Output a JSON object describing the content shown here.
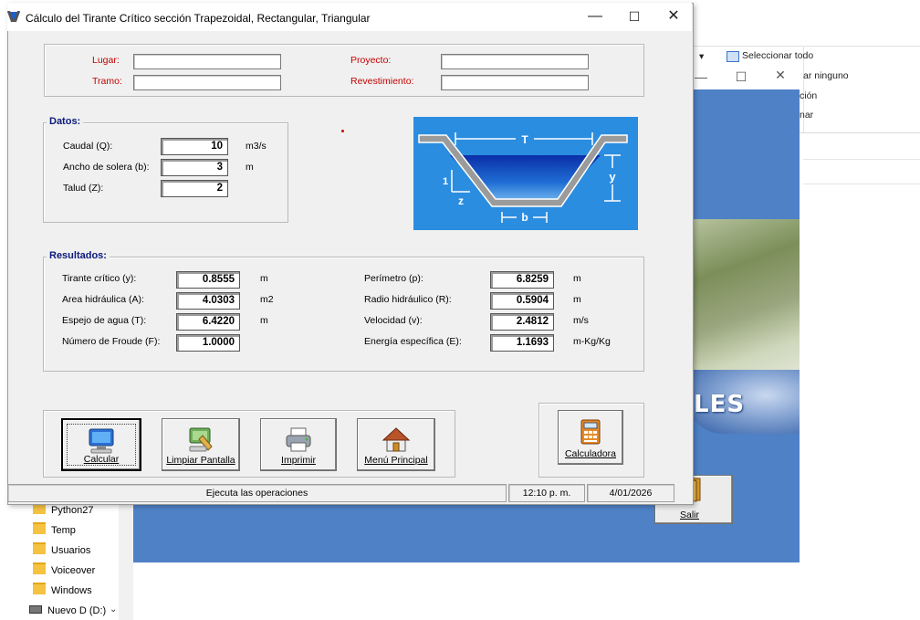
{
  "window": {
    "title": "Cálculo del Tirante Crítico sección Trapezoidal, Rectangular, Triangular",
    "minimize": "—",
    "maximize": "☐",
    "close": "✕"
  },
  "header": {
    "lugar_label": "Lugar:",
    "lugar_value": "",
    "tramo_label": "Tramo:",
    "tramo_value": "",
    "proyecto_label": "Proyecto:",
    "proyecto_value": "",
    "revestimiento_label": "Revestimiento:",
    "revestimiento_value": ""
  },
  "datos": {
    "title": "Datos:",
    "caudal_label": "Caudal (Q):",
    "caudal_value": "10",
    "caudal_unit": "m3/s",
    "solera_label": "Ancho de solera (b):",
    "solera_value": "3",
    "solera_unit": "m",
    "talud_label": "Talud (Z):",
    "talud_value": "2"
  },
  "figure": {
    "T": "T",
    "y": "y",
    "one": "1",
    "z": "z",
    "b": "b",
    "water_color": "#1f6ed4",
    "bg_color": "#2b8de0"
  },
  "resultados": {
    "title": "Resultados:",
    "tirante_label": "Tirante crítico (y):",
    "tirante_value": "0.8555",
    "tirante_unit": "m",
    "area_label": "Area hidráulica (A):",
    "area_value": "4.0303",
    "area_unit": "m2",
    "espejo_label": "Espejo de agua (T):",
    "espejo_value": "6.4220",
    "espejo_unit": "m",
    "froude_label": "Número de Froude (F):",
    "froude_value": "1.0000",
    "perimetro_label": "Perímetro (p):",
    "perimetro_value": "6.8259",
    "perimetro_unit": "m",
    "radio_label": "Radio hidráulico (R):",
    "radio_value": "0.5904",
    "radio_unit": "m",
    "velocidad_label": "Velocidad (v):",
    "velocidad_value": "2.4812",
    "velocidad_unit": "m/s",
    "energia_label": "Energía específica (E):",
    "energia_value": "1.1693",
    "energia_unit": "m-Kg/Kg"
  },
  "buttons": {
    "calcular": "Calcular",
    "limpiar": "Limpiar Pantalla",
    "imprimir": "Imprimir",
    "menu": "Menú Principal",
    "calculadora": "Calculadora"
  },
  "status": {
    "message": "Ejecuta las operaciones",
    "time": "12:10 p. m.",
    "date": "4/01/2026"
  },
  "background": {
    "ribbon_select_all": "Seleccionar todo",
    "ribbon_select_none": "ar ninguno",
    "ribbon_invert": "ción",
    "ribbon_extra": "nar",
    "ribbon_arrow": "▾",
    "menu_app_min": "—",
    "menu_app_max": "☐",
    "menu_app_close": "✕",
    "logo_text": "LES",
    "salir": "Salir",
    "tree_items": [
      "Python27",
      "Temp",
      "Usuarios",
      "Voiceover",
      "Windows",
      "Nuevo D (D:)"
    ],
    "tree_chevron": "⌄"
  }
}
